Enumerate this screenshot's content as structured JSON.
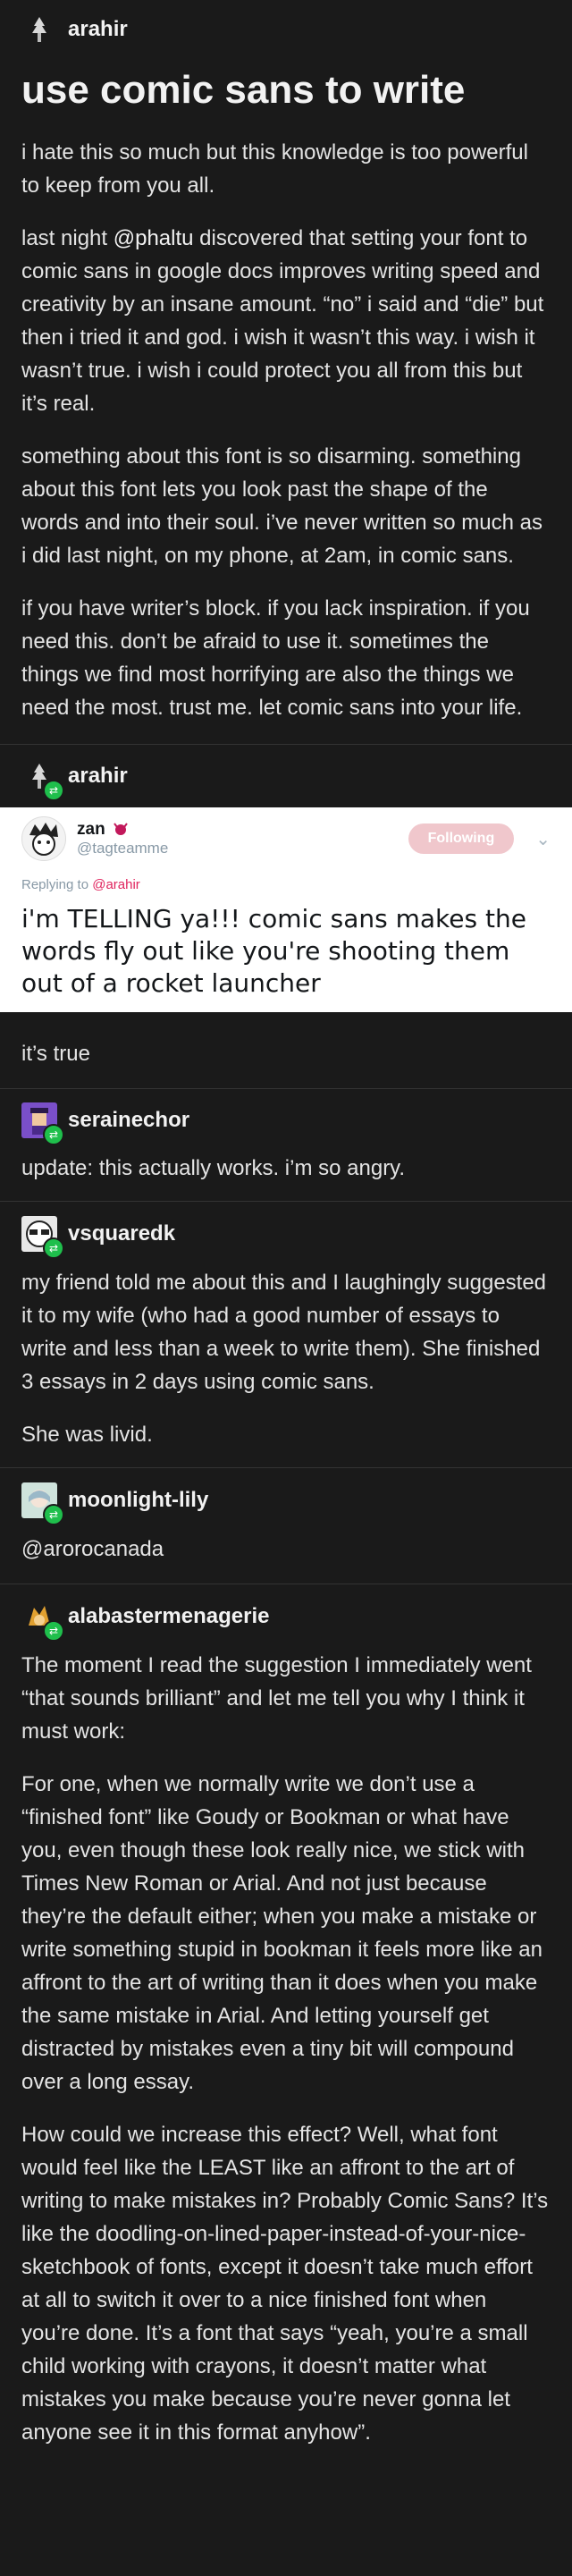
{
  "post1": {
    "username": "arahir",
    "title": "use comic sans to write",
    "p1": "i hate this so much but this knowledge is too powerful to keep from you all.",
    "p2_before": "last night ",
    "p2_mention": "@phaltu",
    "p2_after": " discovered that setting your font to comic sans in google docs improves writing speed and creativity by an insane amount. “no” i said and “die” but then i tried it and god. i wish it wasn’t this way. i wish it wasn’t true. i wish i could protect you all from this but it’s real.",
    "p3": "something about this font is so disarming. something about this font lets you look past the shape of the words and into their soul. i’ve never written so much as i did last night, on my phone, at 2am, in comic sans.",
    "p4": "if you have writer’s block. if you lack inspiration. if you need this. don’t be afraid to use it. sometimes the things we find most horrifying are also the things we need the most. trust me. let comic sans into your life."
  },
  "post2": {
    "username": "arahir",
    "tweet": {
      "name": "zan",
      "handle": "@tagteamme",
      "follow_label": "Following",
      "reply_label": "Replying to ",
      "reply_handle": "@arahir",
      "text": "i'm TELLING ya!!! comic sans makes the words fly out like you're shooting them out of a rocket launcher"
    },
    "text": "it’s true"
  },
  "post3": {
    "username": "serainechor",
    "text": "update: this actually works. i’m so angry."
  },
  "post4": {
    "username": "vsquaredk",
    "p1": "my friend told me about this and I laughingly suggested it to my wife (who had a good number of essays to write and less than a week to write them). She finished 3 essays in 2 days using comic sans.",
    "p2": "She was livid."
  },
  "post5": {
    "username": "moonlight-lily",
    "text": "@arorocanada"
  },
  "post6": {
    "username": "alabastermenagerie",
    "p1": "The moment I read the suggestion I immediately went “that sounds brilliant” and let me tell you why I think it must work:",
    "p2": "For one, when we normally write we don’t use a “finished font” like Goudy or Bookman or what have you, even though these look really nice, we stick with Times New Roman or Arial. And not just because they’re the default either; when you make a mistake or write something stupid in bookman it feels more like an affront to the art of writing than it does when you make the same mistake in Arial. And letting yourself get distracted by mistakes even a tiny bit will compound over a long essay.",
    "p3": "How could we increase this effect? Well, what font would feel like the LEAST like an affront to the art of writing to make mistakes in? Probably Comic Sans? It’s like the doodling-on-lined-paper-instead-of-your-nice-sketchbook of fonts, except it doesn’t take much effort at all to switch it over to a nice finished font when you’re done. It’s a font that says “yeah, you’re a small child working with crayons, it doesn’t matter what mistakes you make because you’re never gonna let anyone see it in this format anyhow”."
  },
  "icons": {
    "reblog": "⇄"
  }
}
